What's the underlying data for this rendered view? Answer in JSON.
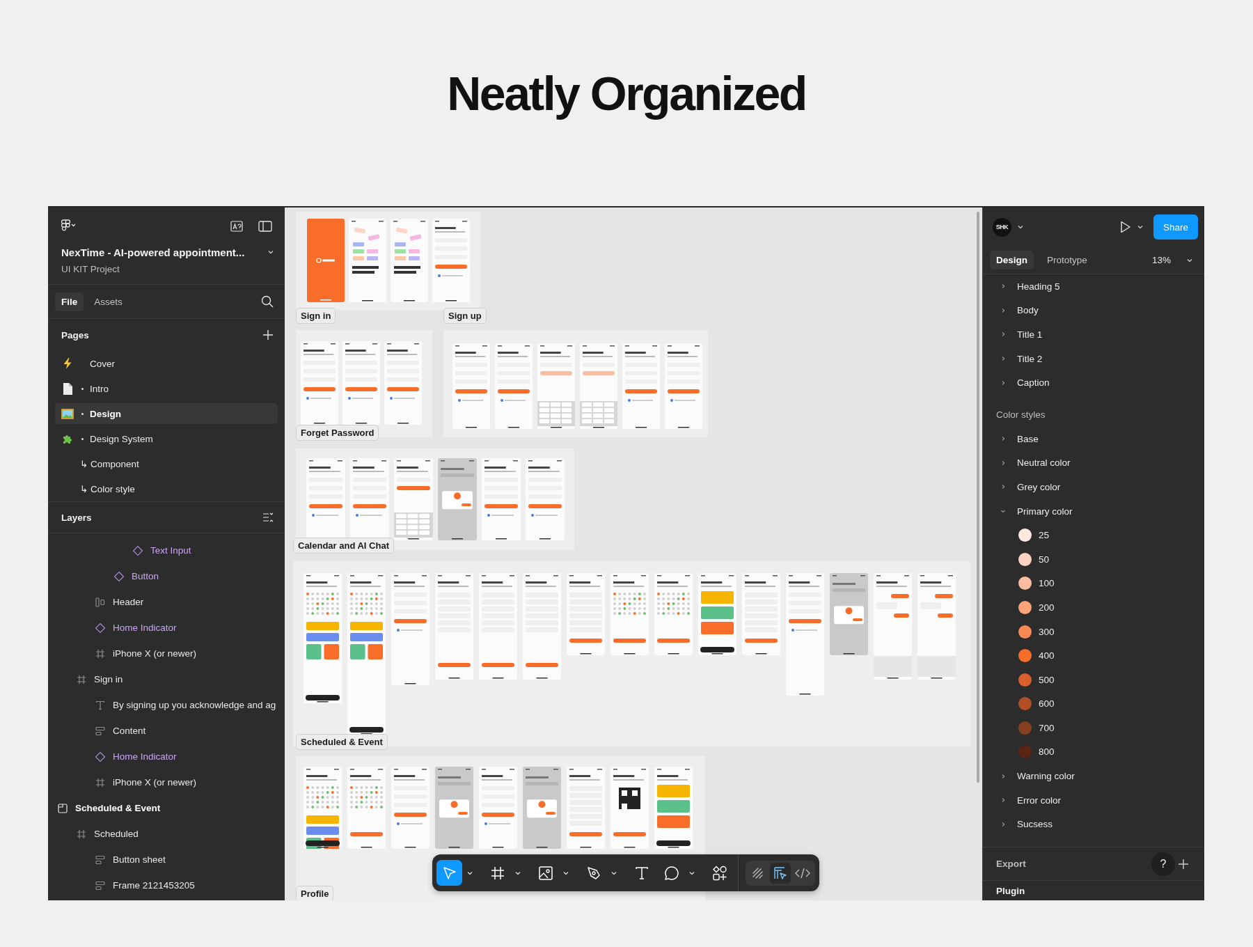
{
  "title": "Neatly Organized",
  "file": {
    "name": "NexTime - AI-powered appointment...",
    "project": "UI KIT Project"
  },
  "left_tabs": [
    {
      "label": "File",
      "selected": true
    },
    {
      "label": "Assets",
      "selected": false
    }
  ],
  "pages": {
    "title": "Pages",
    "items": [
      {
        "label": "Cover",
        "bullet": false,
        "selected": false
      },
      {
        "label": "Intro",
        "bullet": true,
        "selected": false
      },
      {
        "label": "Design",
        "bullet": true,
        "selected": true
      },
      {
        "label": "Design System",
        "bullet": true,
        "selected": false,
        "children": [
          {
            "label": "↳ Component",
            "selected": false
          },
          {
            "label": "↳ Color style",
            "selected": false
          }
        ]
      }
    ]
  },
  "layers": {
    "title": "Layers",
    "items": [
      {
        "children": [
          {
            "children": [
              {
                "children": [
                  {
                    "children": [
                      {
                        "label": "Text Input",
                        "kind": "component"
                      }
                    ]
                  },
                  {
                    "label": "Button",
                    "kind": "component"
                  }
                ]
              },
              {
                "label": "Header",
                "kind": "columns"
              },
              {
                "label": "Home Indicator",
                "kind": "component"
              },
              {
                "label": "iPhone X (or newer)",
                "kind": "frame"
              }
            ]
          },
          {
            "label": "Sign in",
            "kind": "frame",
            "children": [
              {
                "label": "By signing up you acknowledge and ag",
                "kind": "text"
              },
              {
                "label": "Content",
                "kind": "stack"
              },
              {
                "label": "Home Indicator",
                "kind": "component"
              },
              {
                "label": "iPhone X (or newer)",
                "kind": "frame"
              }
            ]
          }
        ]
      },
      {
        "label": "Scheduled & Event",
        "kind": "section",
        "children": [
          {
            "label": "Scheduled",
            "kind": "frame",
            "children": [
              {
                "label": "Button sheet",
                "kind": "stack"
              },
              {
                "label": "Frame 2121453205",
                "kind": "stack"
              }
            ]
          }
        ]
      }
    ]
  },
  "canvas": {
    "sections": [
      {
        "label": "Sign in",
        "screens": [
          {
            "kind": "splash"
          },
          {
            "kind": "onboarding"
          },
          {
            "kind": "onboarding"
          },
          {
            "kind": "form"
          }
        ]
      },
      {
        "label": "Sign up",
        "screens": [
          {
            "kind": "form"
          },
          {
            "kind": "form"
          },
          {
            "kind": "keypad"
          },
          {
            "kind": "keypad"
          },
          {
            "kind": "form"
          },
          {
            "kind": "form"
          }
        ]
      },
      {
        "label": "Forget Password",
        "screens": [
          {
            "kind": "form"
          },
          {
            "kind": "form"
          },
          {
            "kind": "form"
          }
        ]
      },
      {
        "label": "Calendar and AI Chat",
        "screens": [
          {
            "kind": "form"
          },
          {
            "kind": "form"
          },
          {
            "kind": "keyboard"
          },
          {
            "kind": "dimmed"
          },
          {
            "kind": "form"
          },
          {
            "kind": "form"
          }
        ]
      },
      {
        "label": "Scheduled & Event",
        "screens": [
          {
            "kind": "calendar"
          },
          {
            "kind": "calendar"
          },
          {
            "kind": "form"
          },
          {
            "kind": "list"
          },
          {
            "kind": "list"
          },
          {
            "kind": "list"
          },
          {
            "kind": "list"
          },
          {
            "kind": "grid"
          },
          {
            "kind": "grid"
          },
          {
            "kind": "cards"
          },
          {
            "kind": "list"
          },
          {
            "kind": "form"
          },
          {
            "kind": "dimmed"
          },
          {
            "kind": "chat"
          },
          {
            "kind": "chat"
          }
        ]
      },
      {
        "label": "Profile",
        "screens": [
          {
            "kind": "calendar"
          },
          {
            "kind": "grid"
          },
          {
            "kind": "form"
          },
          {
            "kind": "dimmed"
          },
          {
            "kind": "form"
          },
          {
            "kind": "dimmed"
          },
          {
            "kind": "list"
          },
          {
            "kind": "qr"
          },
          {
            "kind": "cards"
          }
        ]
      }
    ]
  },
  "toolbar": {
    "tools": [
      {
        "kind": "move",
        "selected": true,
        "menu": true
      },
      {
        "kind": "frame",
        "selected": false,
        "menu": true
      },
      {
        "kind": "image",
        "selected": false,
        "menu": true
      },
      {
        "kind": "pen",
        "selected": false,
        "menu": true
      },
      {
        "kind": "text",
        "selected": false,
        "menu": false
      },
      {
        "kind": "shape",
        "selected": false,
        "menu": true
      },
      {
        "kind": "actions",
        "selected": false,
        "menu": false
      }
    ],
    "modes": [
      {
        "kind": "draw",
        "selected": false
      },
      {
        "kind": "design",
        "selected": true
      },
      {
        "kind": "dev",
        "selected": false
      }
    ]
  },
  "user": {
    "initials": "SHK"
  },
  "share": "Share",
  "right_tabs": [
    {
      "label": "Design",
      "selected": true
    },
    {
      "label": "Prototype",
      "selected": false
    }
  ],
  "zoom": "13%",
  "text_styles": [
    {
      "label": "Heading 5",
      "expanded": false
    },
    {
      "label": "Body",
      "expanded": false
    },
    {
      "label": "Title 1",
      "expanded": false
    },
    {
      "label": "Title 2",
      "expanded": false
    },
    {
      "label": "Caption",
      "expanded": false
    }
  ],
  "color_styles": {
    "title": "Color styles",
    "groups": [
      {
        "label": "Base",
        "expanded": false
      },
      {
        "label": "Neutral color",
        "expanded": false
      },
      {
        "label": "Grey color",
        "expanded": false
      },
      {
        "label": "Primary color",
        "expanded": true,
        "swatches": [
          {
            "label": "25",
            "color": "#fde8e0"
          },
          {
            "label": "50",
            "color": "#fcd3c2"
          },
          {
            "label": "100",
            "color": "#fbbd9f"
          },
          {
            "label": "200",
            "color": "#f9a37b"
          },
          {
            "label": "300",
            "color": "#f98954"
          },
          {
            "label": "400",
            "color": "#f96d2b"
          },
          {
            "label": "500",
            "color": "#d9602b"
          },
          {
            "label": "600",
            "color": "#b04f25"
          },
          {
            "label": "700",
            "color": "#86401f"
          },
          {
            "label": "800",
            "color": "#5a2512"
          }
        ]
      },
      {
        "label": "Warning color",
        "expanded": false
      },
      {
        "label": "Error color",
        "expanded": false
      },
      {
        "label": "Sucsess",
        "expanded": false
      }
    ]
  },
  "export": "Export",
  "help": "?",
  "plugin": "Plugin"
}
